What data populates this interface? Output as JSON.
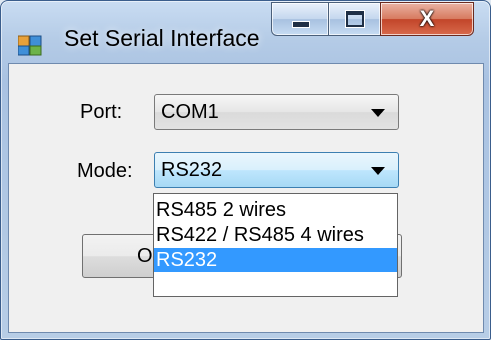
{
  "window": {
    "title": "Set Serial Interface",
    "close_glyph": "X"
  },
  "form": {
    "port_label": "Port:",
    "port_value": "COM1",
    "mode_label": "Mode:",
    "mode_value": "RS232",
    "ok_label": "O"
  },
  "mode_options": {
    "items": [
      "RS485 2 wires",
      "RS422 / RS485 4 wires",
      "RS232"
    ],
    "selected_index": 2
  },
  "colors": {
    "selection": "#3399ff",
    "close_button": "#c2452a"
  }
}
